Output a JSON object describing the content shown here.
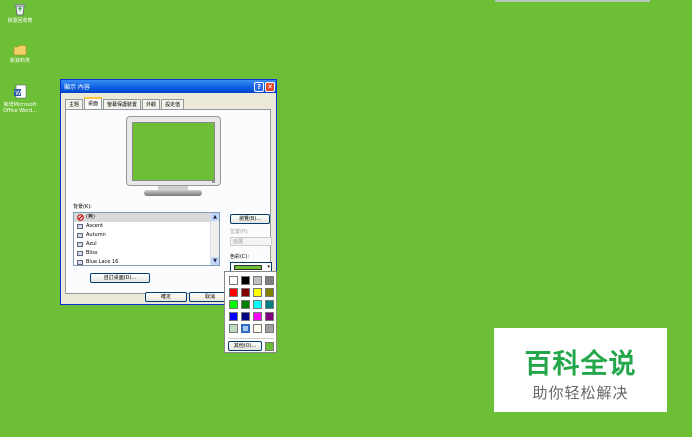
{
  "desktop": {
    "icons": [
      {
        "name": "recycle-bin-icon",
        "label": "資源回收筒"
      },
      {
        "name": "folder-icon",
        "label": "新資料夾"
      },
      {
        "name": "word-document-icon",
        "label": "新增Microsoft Office Word..."
      }
    ]
  },
  "dialog": {
    "title": "顯示 內容",
    "tabs": [
      "主題",
      "桌面",
      "螢幕保護裝置",
      "外觀",
      "設定值"
    ],
    "active_tab": "桌面",
    "background_label": "背景(K):",
    "background_items": [
      "(無)",
      "Ascent",
      "Autumn",
      "Azul",
      "Bliss",
      "Blue Lace 16"
    ],
    "selected_item": "(無)",
    "browse_button": "瀏覽(B)...",
    "position_label": "位置(P):",
    "position_value": "延展",
    "color_label": "色彩(C):",
    "customize_button": "自訂桌面(D)...",
    "ok_button": "確定",
    "cancel_button": "取消"
  },
  "palette": {
    "colors": [
      [
        "#ffffff",
        "#000000",
        "#c0c0c0",
        "#808080"
      ],
      [
        "#ff0000",
        "#800000",
        "#ffff00",
        "#808000"
      ],
      [
        "#00ff00",
        "#008000",
        "#00ffff",
        "#008080"
      ],
      [
        "#0000ff",
        "#000080",
        "#ff00ff",
        "#800080"
      ],
      [
        "#c0dcc0",
        "#a6caf0",
        "#fffbf0",
        "#a0a0a4"
      ]
    ],
    "selected_color": "#a6caf0",
    "other_button": "其他(O)...",
    "current_color": "#6dbf35"
  },
  "watermark": {
    "title": "百科全说",
    "subtitle": "助你轻松解决"
  }
}
